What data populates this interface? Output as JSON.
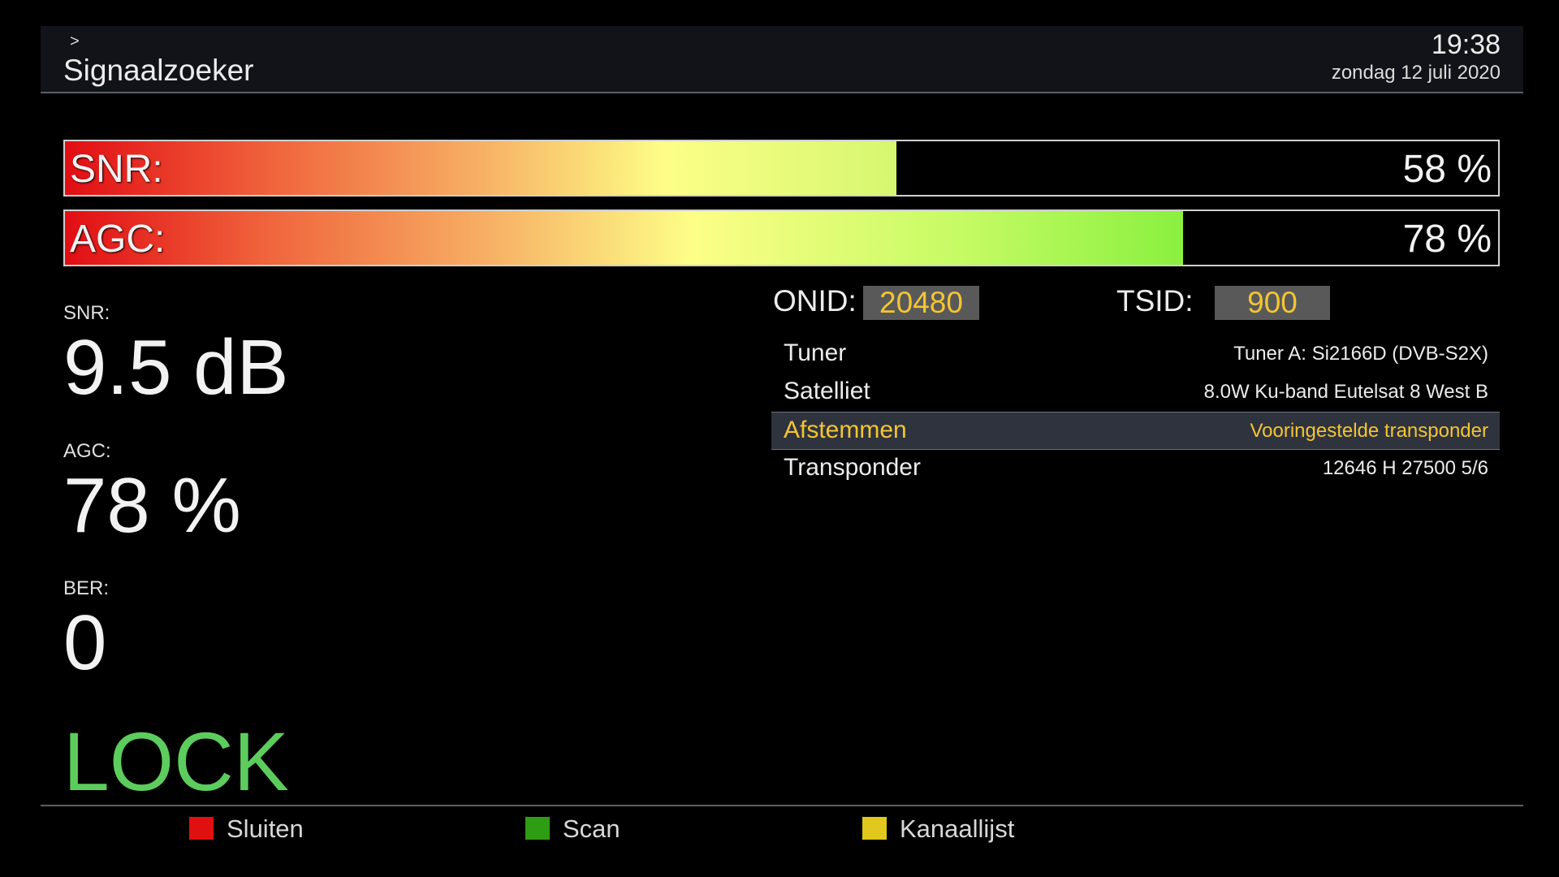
{
  "header": {
    "breadcrumb": ">",
    "title": "Signaalzoeker",
    "time": "19:38",
    "date": "zondag 12 juli 2020"
  },
  "bars": {
    "snr": {
      "label": "SNR:",
      "value_text": "58 %",
      "percent": 58
    },
    "agc": {
      "label": "AGC:",
      "value_text": "78 %",
      "percent": 78
    }
  },
  "stats": {
    "snr_label": "SNR:",
    "snr_value": "9.5 dB",
    "agc_label": "AGC:",
    "agc_value": "78 %",
    "ber_label": "BER:",
    "ber_value": "0",
    "lock": "LOCK"
  },
  "ids": {
    "onid_label": "ONID:",
    "onid_value": "20480",
    "tsid_label": "TSID:",
    "tsid_value": "900"
  },
  "info": [
    {
      "key": "Tuner",
      "value": "Tuner A: Si2166D (DVB-S2X)"
    },
    {
      "key": "Satelliet",
      "value": "8.0W Ku-band Eutelsat 8 West B"
    },
    {
      "key": "Afstemmen",
      "value": "Vooringestelde transponder",
      "selected": true
    },
    {
      "key": "Transponder",
      "value": "12646 H 27500 5/6"
    }
  ],
  "footer": {
    "red_label": "Sluiten",
    "green_label": "Scan",
    "yellow_label": "Kanaallijst"
  },
  "colors": {
    "lock": "#5ccd5c",
    "highlight_text": "#f3c532",
    "red_key": "#e01010",
    "green_key": "#2e9d14",
    "yellow_key": "#e0c81c"
  }
}
